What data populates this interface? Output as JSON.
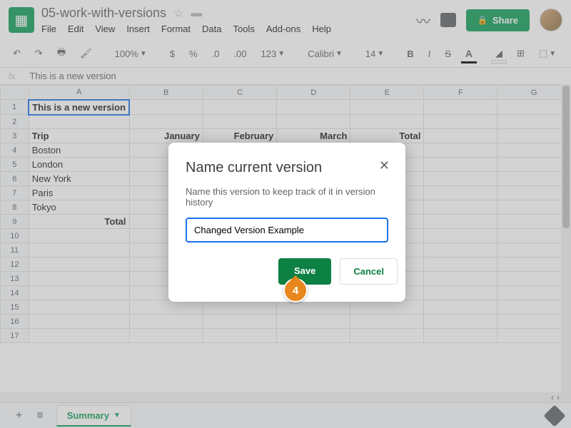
{
  "doc": {
    "title": "05-work-with-versions"
  },
  "menus": {
    "file": "File",
    "edit": "Edit",
    "view": "View",
    "insert": "Insert",
    "format": "Format",
    "data": "Data",
    "tools": "Tools",
    "addons": "Add-ons",
    "help": "Help"
  },
  "share": {
    "label": "Share"
  },
  "toolbar": {
    "zoom": "100%",
    "num_fmt": "123",
    "font": "Calibri",
    "size": "14",
    "bold": "B",
    "italic": "I",
    "strike": "S",
    "more": "⋯"
  },
  "formula_bar": {
    "fx": "fx",
    "value": "This is a new version"
  },
  "columns": [
    "A",
    "B",
    "C",
    "D",
    "E",
    "F",
    "G"
  ],
  "rows": [
    "1",
    "2",
    "3",
    "4",
    "5",
    "6",
    "7",
    "8",
    "9",
    "10",
    "11",
    "12",
    "13",
    "14",
    "15",
    "16",
    "17"
  ],
  "cells": {
    "a1": "This is a new version",
    "a3": "Trip",
    "b3": "January",
    "c3": "February",
    "d3": "March",
    "e3": "Total",
    "a4": "Boston",
    "a5": "London",
    "a6": "New York",
    "a7": "Paris",
    "a8": "Tokyo",
    "a9": "Total"
  },
  "sheet_tab": {
    "name": "Summary"
  },
  "modal": {
    "title": "Name current version",
    "desc": "Name this version to keep track of it in version history",
    "input_value": "Changed Version Example",
    "save": "Save",
    "cancel": "Cancel"
  },
  "callout": {
    "num": "4"
  }
}
